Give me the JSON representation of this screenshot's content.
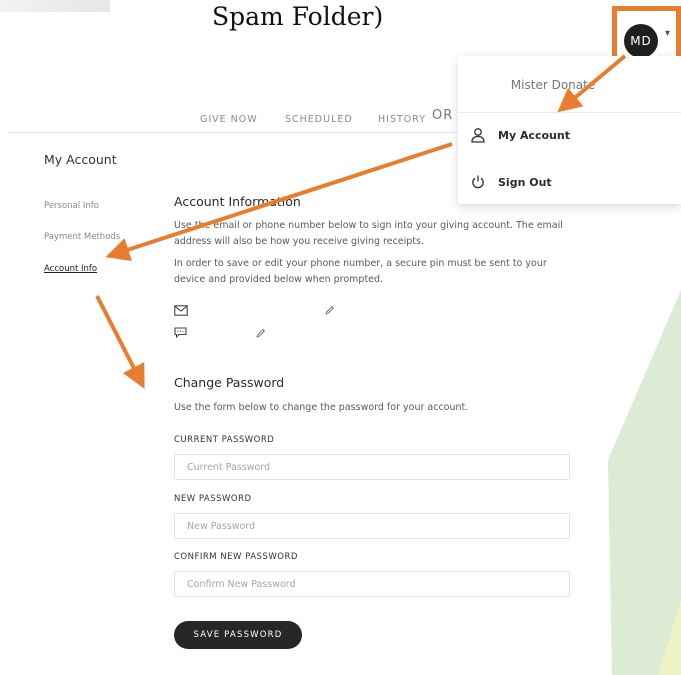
{
  "header": {
    "title": "Spam Folder)"
  },
  "avatar": {
    "initials": "MD"
  },
  "nav": {
    "items": [
      {
        "label": "GIVE NOW"
      },
      {
        "label": "SCHEDULED"
      },
      {
        "label": "HISTORY"
      },
      {
        "label": "OR"
      }
    ]
  },
  "dropdown": {
    "user_name": "Mister Donate",
    "items": [
      {
        "label": "My Account",
        "icon": "user-icon"
      },
      {
        "label": "Sign Out",
        "icon": "power-icon"
      }
    ]
  },
  "sidebar": {
    "title": "My Account",
    "items": [
      {
        "label": "Personal Info"
      },
      {
        "label": "Payment Methods"
      },
      {
        "label": "Account Info",
        "active": true
      }
    ]
  },
  "account_info": {
    "heading": "Account Information",
    "para1": "Use the email or phone number below to sign into your giving account. The email address will also be how you receive giving receipts.",
    "para2": "In order to save or edit your phone number, a secure pin must be sent to your device and provided below when prompted.",
    "email_icon": "mail-icon",
    "phone_icon": "chat-icon",
    "edit_icon": "pencil-icon"
  },
  "change_password": {
    "heading": "Change Password",
    "description": "Use the form below to change the password for your account.",
    "current_label": "CURRENT PASSWORD",
    "current_placeholder": "Current Password",
    "new_label": "NEW PASSWORD",
    "new_placeholder": "New Password",
    "confirm_label": "CONFIRM NEW PASSWORD",
    "confirm_placeholder": "Confirm New Password",
    "save_label": "SAVE PASSWORD"
  },
  "colors": {
    "annotation": "#e87d2e",
    "button": "#272727",
    "green_tint": "#dcebd3",
    "yellow_tint": "#f0f3c9"
  }
}
